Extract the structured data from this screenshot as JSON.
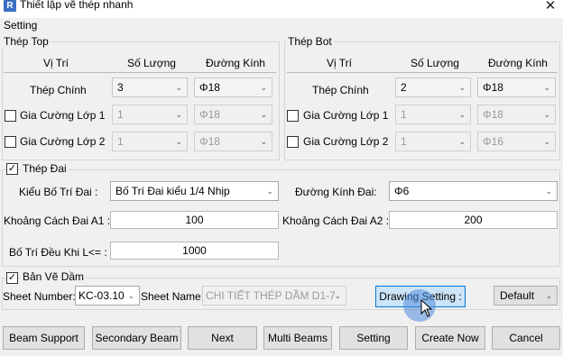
{
  "window": {
    "title": "Thiết lập vẽ thép nhanh",
    "app_icon_letter": "R",
    "close": "✕"
  },
  "setting_label": "Setting",
  "top": {
    "title": "Thép Top",
    "headers": [
      "Vị Trí",
      "Số Lượng",
      "Đường Kính"
    ],
    "rows": [
      {
        "label": "Thép Chính",
        "qty": "3",
        "dia": "Φ18",
        "checkbox": false,
        "checked": false
      },
      {
        "label": "Gia Cường Lớp 1",
        "qty": "1",
        "dia": "Φ18",
        "checkbox": true,
        "checked": false
      },
      {
        "label": "Gia Cường Lớp 2",
        "qty": "1",
        "dia": "Φ18",
        "checkbox": true,
        "checked": false
      }
    ]
  },
  "bot": {
    "title": "Thép Bot",
    "headers": [
      "Vị Trí",
      "Số Lượng",
      "Đường Kính"
    ],
    "rows": [
      {
        "label": "Thép Chính",
        "qty": "2",
        "dia": "Φ18",
        "checkbox": false,
        "checked": false
      },
      {
        "label": "Gia Cường Lớp 1",
        "qty": "1",
        "dia": "Φ18",
        "checkbox": true,
        "checked": false
      },
      {
        "label": "Gia Cường Lớp 2",
        "qty": "1",
        "dia": "Φ16",
        "checkbox": true,
        "checked": false
      }
    ]
  },
  "stirrup": {
    "title": "Thép Đai",
    "checked": true,
    "layout_label": "Kiểu Bố Trí Đai :",
    "layout_value": "Bố Trí Đai kiểu 1/4 Nhịp",
    "dia_label": "Đường Kính Đai:",
    "dia_value": "Φ6",
    "a1_label": "Khoảng Cách Đai A1 :",
    "a1_value": "100",
    "a2_label": "Khoảng Cách Đai A2 :",
    "a2_value": "200",
    "even_label": "Bố Trí Đều Khi L<= :",
    "even_value": "1000"
  },
  "drawing": {
    "title": "Bản Vẽ Dầm",
    "checked": true,
    "sheet_number_label": "Sheet Number:",
    "sheet_number_value": "KC-03.10",
    "sheet_name_label": "Sheet Name:",
    "sheet_name_value": "CHI TIẾT THÉP DẦM D1-7",
    "drawing_setting_label": "Drawing Setting :",
    "default_value": "Default"
  },
  "buttons": {
    "beam_support": "Beam Support",
    "secondary_beam": "Secondary Beam",
    "next": "Next",
    "multi_beams": "Multi Beams",
    "setting": "Setting",
    "create_now": "Create Now",
    "cancel": "Cancel"
  },
  "icons": {
    "chevron": "⌄",
    "check": "✓"
  }
}
